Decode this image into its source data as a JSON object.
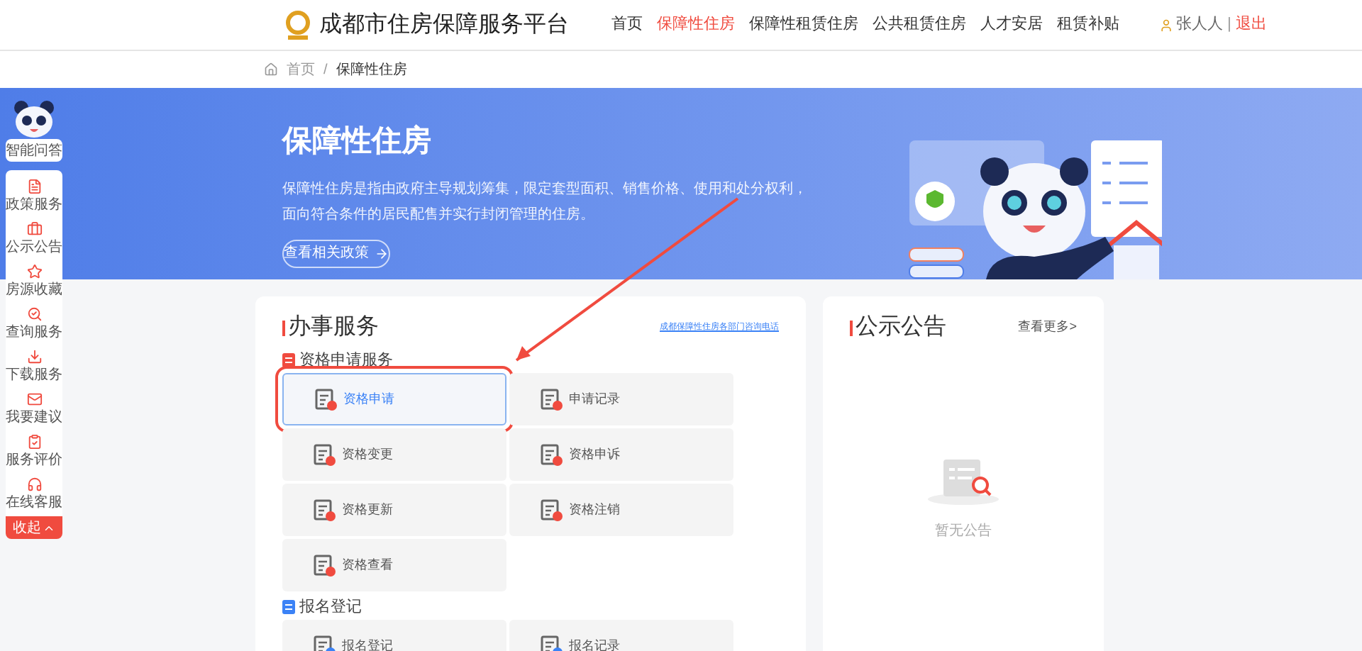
{
  "header": {
    "title": "成都市住房保障服务平台",
    "nav": [
      {
        "label": "首页",
        "selected": false
      },
      {
        "label": "保障性住房",
        "selected": true
      },
      {
        "label": "保障性租赁住房",
        "selected": false
      },
      {
        "label": "公共租赁住房",
        "selected": false
      },
      {
        "label": "人才安居",
        "selected": false
      },
      {
        "label": "租赁补贴",
        "selected": false
      }
    ],
    "user": "张人人",
    "separator": "|",
    "logout": "退出"
  },
  "breadcrumb": [
    "首页",
    "/",
    "保障性住房"
  ],
  "banner": {
    "title": "保障性住房",
    "description": [
      "保障性住房是指由政府主导规划筹集，限定套型面积、销售价格、使用和处分权利，",
      "面向符合条件的居民配售并实行封闭管理的住房。"
    ],
    "button": "查看相关政策"
  },
  "sidebar": {
    "assistant": "智能问答",
    "items": [
      {
        "label": "政策服务",
        "kind": "policy"
      },
      {
        "label": "公示公告",
        "kind": "notice"
      },
      {
        "label": "房源收藏",
        "kind": "star"
      },
      {
        "label": "查询服务",
        "kind": "search"
      },
      {
        "label": "下载服务",
        "kind": "download"
      },
      {
        "label": "我要建议",
        "kind": "mail"
      },
      {
        "label": "服务评价",
        "kind": "rate"
      },
      {
        "label": "在线客服",
        "kind": "support"
      }
    ],
    "collapse": "收起"
  },
  "services": {
    "title": "办事服务",
    "link": "成都保障性住房各部门咨询电话",
    "sections": [
      {
        "title": "资格申请服务",
        "color": "#f04b3f",
        "items": [
          {
            "label": "资格申请",
            "highlighted": true
          },
          {
            "label": "申请记录",
            "highlighted": false
          },
          {
            "label": "资格变更",
            "highlighted": false
          },
          {
            "label": "资格申诉",
            "highlighted": false
          },
          {
            "label": "资格更新",
            "highlighted": false
          },
          {
            "label": "资格注销",
            "highlighted": false
          },
          {
            "label": "资格查看",
            "highlighted": false
          }
        ]
      },
      {
        "title": "报名登记",
        "color": "#3b82f6",
        "items": [
          {
            "label": "报名登记",
            "highlighted": false
          },
          {
            "label": "报名记录",
            "highlighted": false
          }
        ]
      }
    ]
  },
  "notices": {
    "title": "公示公告",
    "more": "查看更多>",
    "empty_text": "暂无公告"
  }
}
